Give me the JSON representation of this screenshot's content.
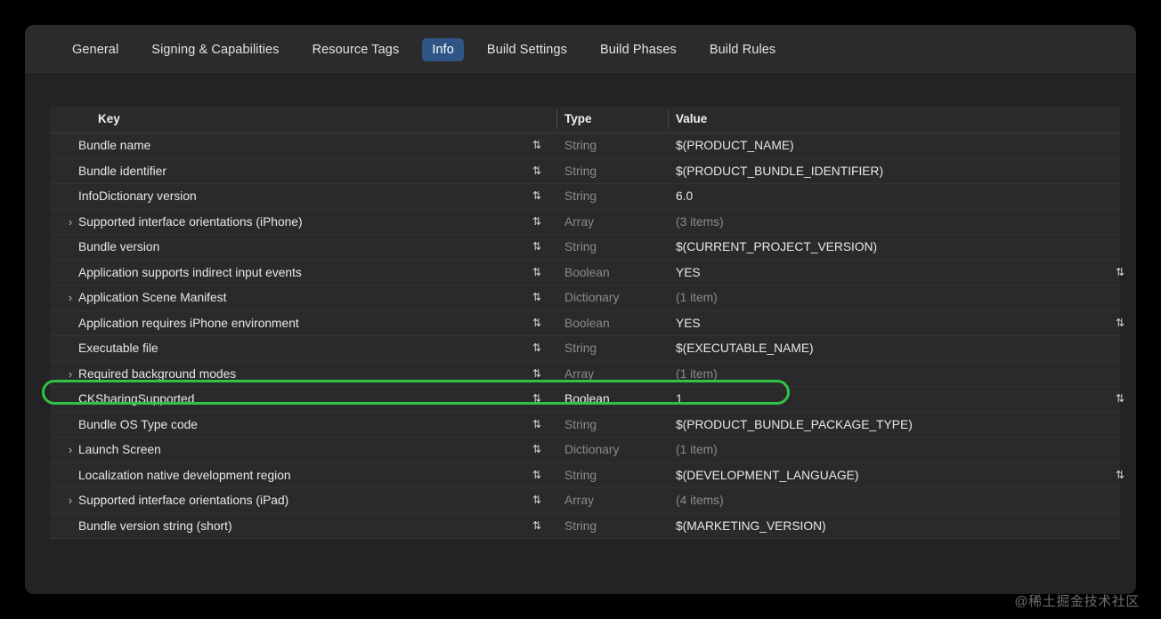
{
  "window": {
    "tabs": [
      {
        "label": "General",
        "selected": false
      },
      {
        "label": "Signing & Capabilities",
        "selected": false
      },
      {
        "label": "Resource Tags",
        "selected": false
      },
      {
        "label": "Info",
        "selected": true
      },
      {
        "label": "Build Settings",
        "selected": false
      },
      {
        "label": "Build Phases",
        "selected": false
      },
      {
        "label": "Build Rules",
        "selected": false
      }
    ]
  },
  "table": {
    "columns": {
      "key": "Key",
      "type": "Type",
      "value": "Value"
    },
    "rows": [
      {
        "key": "Bundle name",
        "type": "String",
        "value": "$(PRODUCT_NAME)",
        "expandable": false,
        "muted_value": false,
        "stepper": true,
        "right_stepper": false,
        "highlighted": false
      },
      {
        "key": "Bundle identifier",
        "type": "String",
        "value": "$(PRODUCT_BUNDLE_IDENTIFIER)",
        "expandable": false,
        "muted_value": false,
        "stepper": true,
        "right_stepper": false,
        "highlighted": false
      },
      {
        "key": "InfoDictionary version",
        "type": "String",
        "value": "6.0",
        "expandable": false,
        "muted_value": false,
        "stepper": true,
        "right_stepper": false,
        "highlighted": false
      },
      {
        "key": "Supported interface orientations (iPhone)",
        "type": "Array",
        "value": "(3 items)",
        "expandable": true,
        "muted_value": true,
        "stepper": true,
        "right_stepper": false,
        "highlighted": false
      },
      {
        "key": "Bundle version",
        "type": "String",
        "value": "$(CURRENT_PROJECT_VERSION)",
        "expandable": false,
        "muted_value": false,
        "stepper": true,
        "right_stepper": false,
        "highlighted": false
      },
      {
        "key": "Application supports indirect input events",
        "type": "Boolean",
        "value": "YES",
        "expandable": false,
        "muted_value": false,
        "stepper": true,
        "right_stepper": true,
        "highlighted": false
      },
      {
        "key": "Application Scene Manifest",
        "type": "Dictionary",
        "value": "(1 item)",
        "expandable": true,
        "muted_value": true,
        "stepper": true,
        "right_stepper": false,
        "highlighted": false
      },
      {
        "key": "Application requires iPhone environment",
        "type": "Boolean",
        "value": "YES",
        "expandable": false,
        "muted_value": false,
        "stepper": true,
        "right_stepper": true,
        "highlighted": false
      },
      {
        "key": "Executable file",
        "type": "String",
        "value": "$(EXECUTABLE_NAME)",
        "expandable": false,
        "muted_value": false,
        "stepper": true,
        "right_stepper": false,
        "highlighted": false
      },
      {
        "key": "Required background modes",
        "type": "Array",
        "value": "(1 item)",
        "expandable": true,
        "muted_value": true,
        "stepper": true,
        "right_stepper": false,
        "highlighted": false
      },
      {
        "key": "CKSharingSupported",
        "type": "Boolean",
        "value": "1",
        "expandable": false,
        "muted_value": false,
        "stepper": true,
        "right_stepper": true,
        "highlighted": true
      },
      {
        "key": "Bundle OS Type code",
        "type": "String",
        "value": "$(PRODUCT_BUNDLE_PACKAGE_TYPE)",
        "expandable": false,
        "muted_value": false,
        "stepper": true,
        "right_stepper": false,
        "highlighted": false
      },
      {
        "key": "Launch Screen",
        "type": "Dictionary",
        "value": "(1 item)",
        "expandable": true,
        "muted_value": true,
        "stepper": true,
        "right_stepper": false,
        "highlighted": false
      },
      {
        "key": "Localization native development region",
        "type": "String",
        "value": "$(DEVELOPMENT_LANGUAGE)",
        "expandable": false,
        "muted_value": false,
        "stepper": true,
        "right_stepper": true,
        "highlighted": false
      },
      {
        "key": "Supported interface orientations (iPad)",
        "type": "Array",
        "value": "(4 items)",
        "expandable": true,
        "muted_value": true,
        "stepper": true,
        "right_stepper": false,
        "highlighted": false
      },
      {
        "key": "Bundle version string (short)",
        "type": "String",
        "value": "$(MARKETING_VERSION)",
        "expandable": false,
        "muted_value": false,
        "stepper": true,
        "right_stepper": false,
        "highlighted": false
      }
    ]
  },
  "icons": {
    "disclosure": "›",
    "stepper": "⇅"
  },
  "annotation": {
    "color": "#31c243",
    "target_key": "CKSharingSupported"
  },
  "watermark": {
    "text": "@稀土掘金技术社区"
  }
}
